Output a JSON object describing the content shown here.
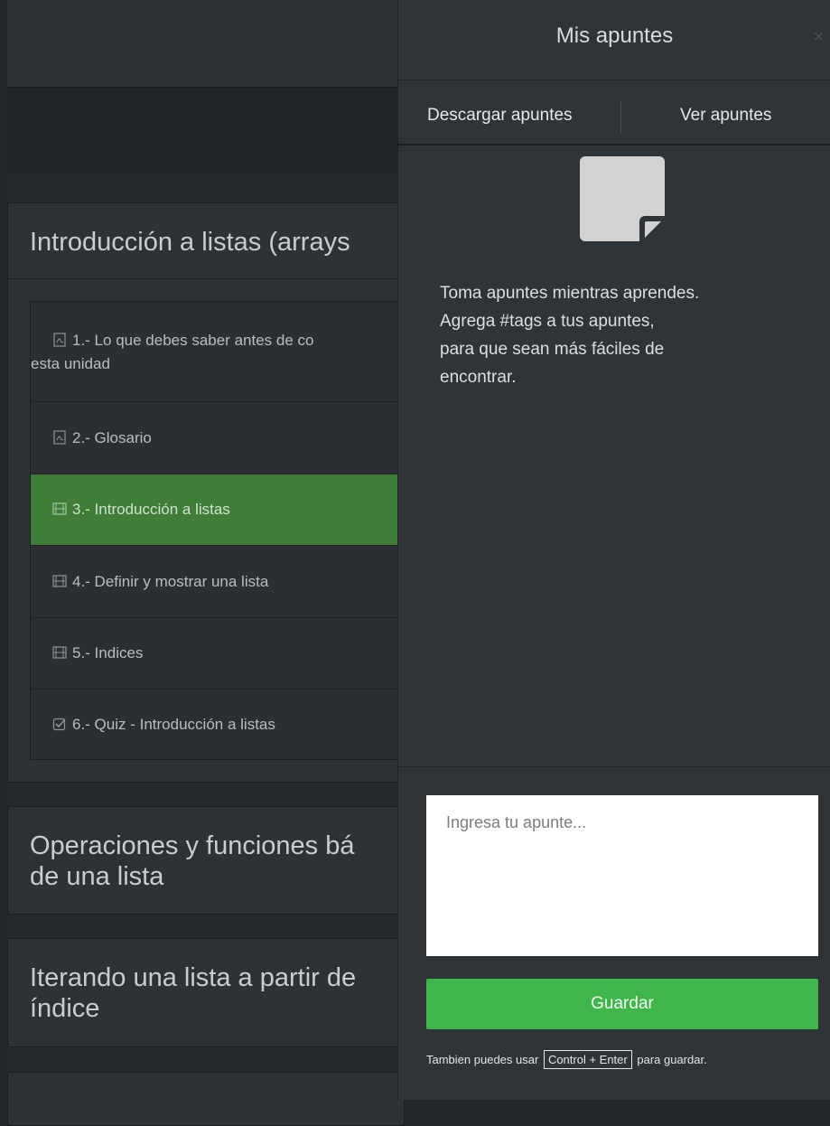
{
  "course": {
    "sections": [
      {
        "title": "Introducción a listas (arrays"
      },
      {
        "title_line1": "Operaciones y funciones bá",
        "title_line2": "de una lista"
      },
      {
        "title_line1": "Iterando una lista a partir de",
        "title_line2": "índice"
      }
    ],
    "lessons": [
      {
        "icon": "pdf-icon",
        "label_line1": "1.- Lo que debes saber antes de co",
        "label_line2": "esta unidad"
      },
      {
        "icon": "pdf-icon",
        "label": "2.- Glosario"
      },
      {
        "icon": "video-icon",
        "label": "3.- Introducción a listas",
        "active": true
      },
      {
        "icon": "video-icon",
        "label": "4.- Definir y mostrar una lista"
      },
      {
        "icon": "video-icon",
        "label": "5.- Indices"
      },
      {
        "icon": "check-square-icon",
        "label": "6.- Quiz - Introducción a listas"
      }
    ]
  },
  "notes_panel": {
    "title": "Mis apuntes",
    "close_glyph": "×",
    "tabs": {
      "download": "Descargar apuntes",
      "view": "Ver apuntes"
    },
    "empty_icon": "sticky-note-icon",
    "empty_text": [
      "Toma apuntes mientras aprendes.",
      "Agrega #tags a tus apuntes,",
      "para que sean más fáciles de",
      "encontrar."
    ],
    "input_placeholder": "Ingresa tu apunte...",
    "save_label": "Guardar",
    "hint_prefix": "Tambien puedes usar",
    "hint_key": "Control + Enter",
    "hint_suffix": "para guardar."
  },
  "colors": {
    "accent_green": "#3fb54a",
    "active_lesson": "#3f7d39",
    "panel_bg": "#2f3438",
    "page_bg": "#23272b"
  }
}
